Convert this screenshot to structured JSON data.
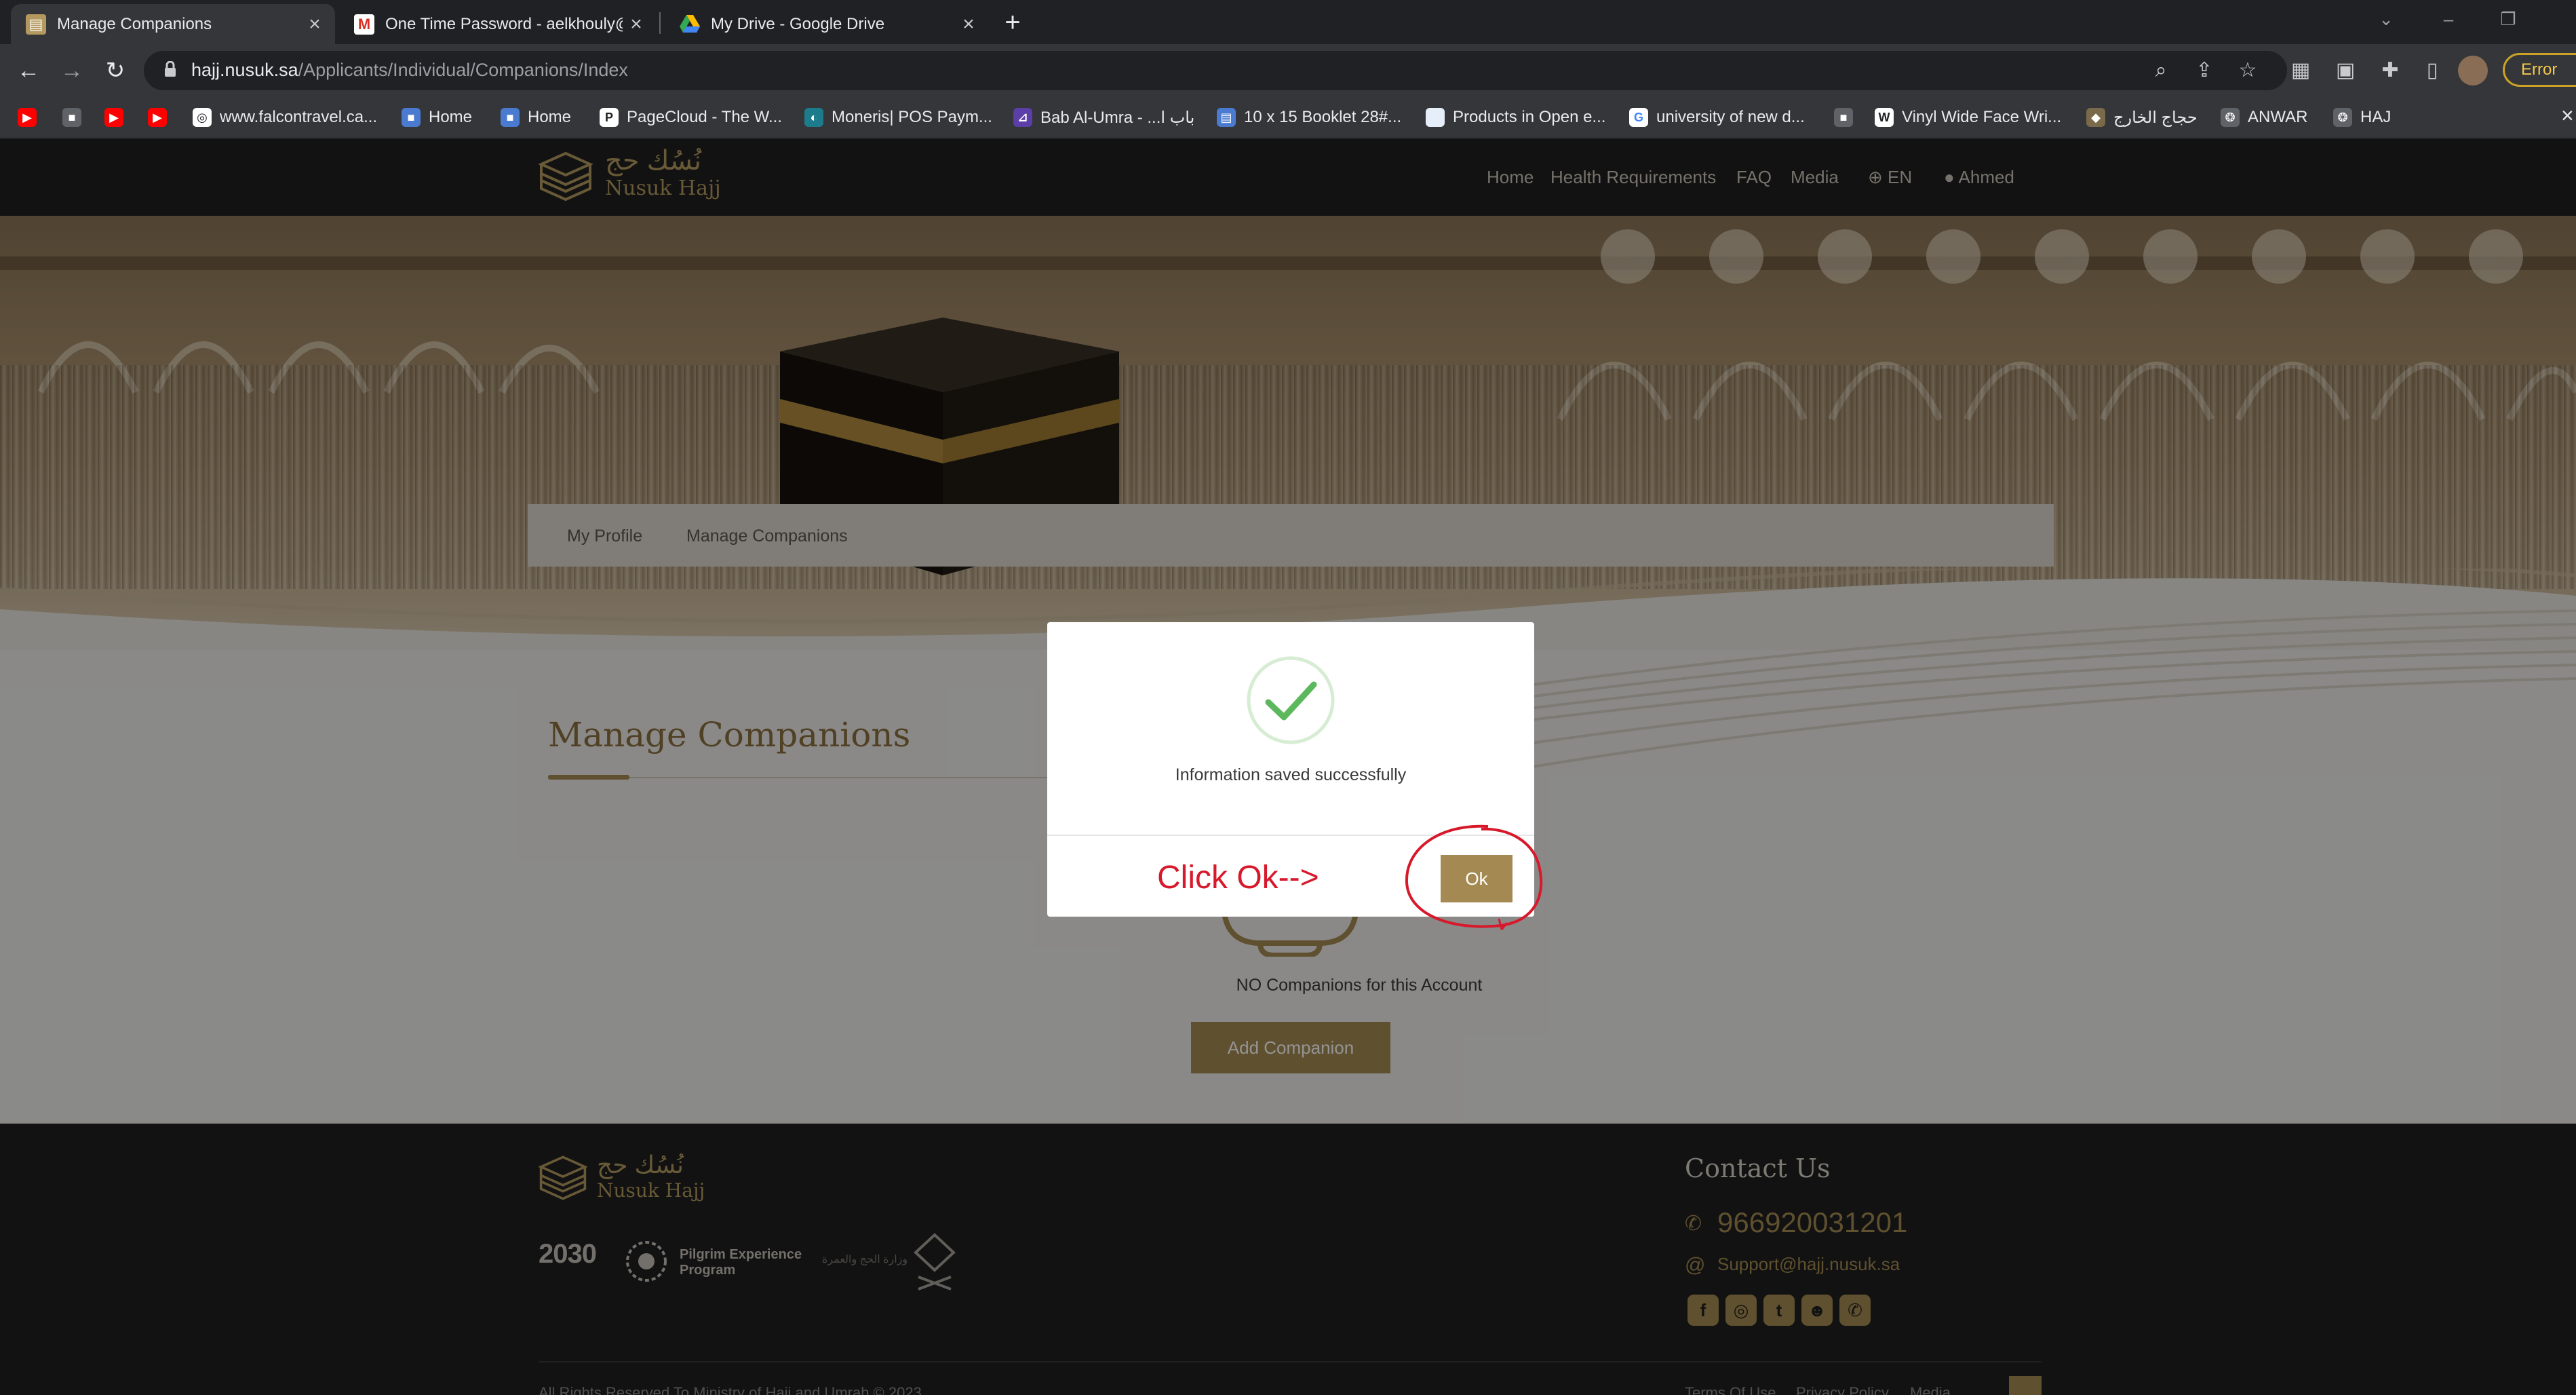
{
  "browser": {
    "tabs": [
      {
        "title": "Manage Companions",
        "active": true
      },
      {
        "title": "One Time Password - aelkhouly@",
        "active": false
      },
      {
        "title": "My Drive - Google Drive",
        "active": false
      }
    ],
    "url_host": "hajj.nusuk.sa",
    "url_path": "/Applicants/Individual/Companions/Index",
    "profile_status": "Error",
    "bookmarks": [
      {
        "label": "",
        "icon": "youtube-icon"
      },
      {
        "label": "",
        "icon": "page-icon"
      },
      {
        "label": "",
        "icon": "youtube-icon"
      },
      {
        "label": "",
        "icon": "youtube-icon"
      },
      {
        "label": "www.falcontravel.ca...",
        "icon": "globe-icon"
      },
      {
        "label": "Home",
        "icon": "page-icon"
      },
      {
        "label": "Home",
        "icon": "page-icon"
      },
      {
        "label": "PageCloud - The W...",
        "icon": "pagecloud-icon"
      },
      {
        "label": "Moneris| POS Paym...",
        "icon": "moneris-icon"
      },
      {
        "label": "Bab Al-Umra - ...باب ا",
        "icon": "bab-icon"
      },
      {
        "label": "10 x 15 Booklet 28#...",
        "icon": "booklet-icon"
      },
      {
        "label": "Products in Open e...",
        "icon": "products-icon"
      },
      {
        "label": "university of new d...",
        "icon": "google-icon"
      },
      {
        "label": "",
        "icon": "page-icon"
      },
      {
        "label": "Vinyl Wide Face Wri...",
        "icon": "vinyl-icon"
      },
      {
        "label": "حجاج الخارج",
        "icon": "hajj-icon"
      },
      {
        "label": "ANWAR",
        "icon": "anwar-icon"
      },
      {
        "label": "HAJ",
        "icon": "haj-icon"
      }
    ]
  },
  "site": {
    "logo_ar": "نُسُك حج",
    "logo_en": "Nusuk Hajj",
    "nav": [
      "Home",
      "Health Requirements",
      "FAQ",
      "Media"
    ],
    "language": "EN",
    "user": "Ahmed",
    "profile_tabs": [
      "My Profile",
      "Manage Companions"
    ],
    "page_title": "Manage Companions",
    "empty_message": "NO Companions for this Account",
    "add_button": "Add Companion"
  },
  "footer": {
    "logo_ar": "نُسُك حج",
    "logo_en": "Nusuk Hajj",
    "vision": "2030",
    "program_line1": "Pilgrim Experience",
    "program_line2": "Program",
    "ministry_ar": "وزارة الحج والعمرة",
    "contact_title": "Contact Us",
    "phone": "966920031201",
    "email": "Support@hajj.nusuk.sa",
    "copyright": "All Rights Reserved To Ministry of Hajj and Umrah © 2023",
    "links": [
      "Terms Of Use",
      "Privacy Policy",
      "Media"
    ]
  },
  "modal": {
    "message": "Information saved successfully",
    "ok_label": "Ok",
    "annotation": "Click Ok-->"
  },
  "colors": {
    "gold": "#a48a52",
    "header_dark": "#1f1f1f",
    "annotation_red": "#d7192b",
    "success_green": "#5cb85c"
  }
}
